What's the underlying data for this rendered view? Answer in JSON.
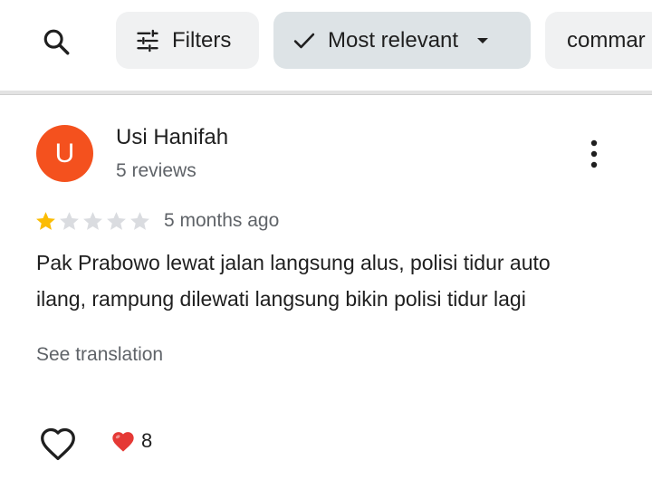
{
  "toolbar": {
    "search_icon": "search-icon",
    "filters_label": "Filters",
    "sort_label": "Most relevant",
    "chip_partial_label": "commar"
  },
  "review": {
    "avatar_letter": "U",
    "avatar_color": "#f4511e",
    "author": "Usi Hanifah",
    "author_reviews": "5 reviews",
    "rating": 1,
    "rating_max": 5,
    "time_ago": "5 months ago",
    "text_line1": "Pak Prabowo lewat jalan langsung alus, polisi tidur auto",
    "text_line2": "ilang, rampung dilewati langsung bikin polisi tidur lagi",
    "see_translation": "See translation",
    "reaction_emoji": "❤️",
    "reaction_count": "8"
  },
  "colors": {
    "star_filled": "#fbbc04",
    "star_empty": "#dadce0",
    "chip_selected": "#dde3e6",
    "chip_default": "#f0f1f2"
  }
}
